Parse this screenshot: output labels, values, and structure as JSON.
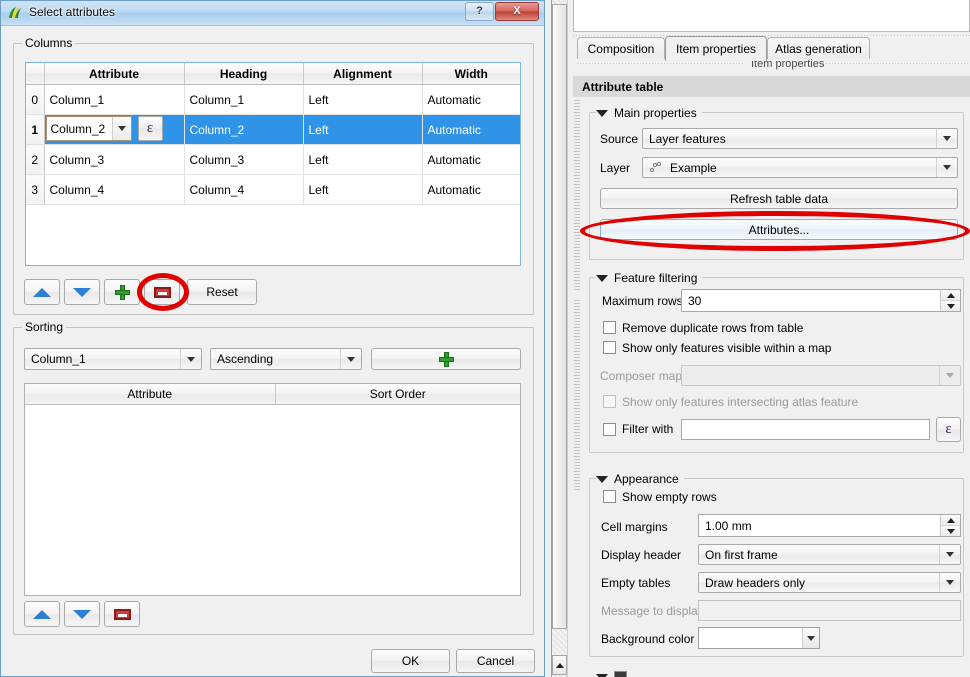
{
  "dialog": {
    "title": "Select attributes",
    "icon": "qgis-logo-icon",
    "help_label": "?",
    "close_label": "X",
    "columns_group": {
      "title": "Columns",
      "headers": [
        "",
        "Attribute",
        "Heading",
        "Alignment",
        "Width"
      ],
      "rows": [
        {
          "index": "0",
          "attribute": "Column_1",
          "heading": "Column_1",
          "alignment": "Left",
          "width": "Automatic",
          "selected": false,
          "editing": false
        },
        {
          "index": "1",
          "attribute": "Column_2",
          "heading": "Column_2",
          "alignment": "Left",
          "width": "Automatic",
          "selected": true,
          "editing": true
        },
        {
          "index": "2",
          "attribute": "Column_3",
          "heading": "Column_3",
          "alignment": "Left",
          "width": "Automatic",
          "selected": false,
          "editing": false
        },
        {
          "index": "3",
          "attribute": "Column_4",
          "heading": "Column_4",
          "alignment": "Left",
          "width": "Automatic",
          "selected": false,
          "editing": false
        }
      ],
      "expression_button_label": "ε",
      "toolbar": {
        "move_up": "move-up-icon",
        "move_down": "move-down-icon",
        "add": "add-icon",
        "remove": "remove-icon",
        "reset_label": "Reset"
      }
    },
    "sorting_group": {
      "title": "Sorting",
      "attribute_value": "Column_1",
      "order_value": "Ascending",
      "add_label": "add-icon",
      "headers": [
        "Attribute",
        "Sort Order"
      ],
      "rows": [],
      "toolbar": {
        "move_up": "move-up-icon",
        "move_down": "move-down-icon",
        "remove": "remove-icon"
      }
    },
    "ok_label": "OK",
    "cancel_label": "Cancel"
  },
  "right_panel": {
    "tabs": [
      {
        "label": "Composition",
        "active": false
      },
      {
        "label": "Item properties",
        "active": true
      },
      {
        "label": "Atlas generation",
        "active": false
      }
    ],
    "dock_title": "Item properties",
    "panel_header": "Attribute table",
    "main_properties": {
      "title": "Main properties",
      "source_label": "Source",
      "source_value": "Layer features",
      "layer_label": "Layer",
      "layer_value": "Example",
      "refresh_label": "Refresh table data",
      "attributes_label": "Attributes..."
    },
    "feature_filtering": {
      "title": "Feature filtering",
      "max_rows_label": "Maximum rows",
      "max_rows_value": "30",
      "remove_duplicates_label": "Remove duplicate rows from table",
      "remove_duplicates_checked": false,
      "visible_within_map_label": "Show only features visible within a map",
      "visible_within_map_checked": false,
      "composer_map_label": "Composer map",
      "composer_map_value": "",
      "intersecting_atlas_label": "Show only features intersecting atlas feature",
      "intersecting_atlas_checked": false,
      "filter_with_label": "Filter with",
      "filter_with_checked": false,
      "filter_with_value": "",
      "expression_button_label": "ε"
    },
    "appearance": {
      "title": "Appearance",
      "show_empty_rows_label": "Show empty rows",
      "show_empty_rows_checked": false,
      "cell_margins_label": "Cell margins",
      "cell_margins_value": "1.00 mm",
      "display_header_label": "Display header",
      "display_header_value": "On first frame",
      "empty_tables_label": "Empty tables",
      "empty_tables_value": "Draw headers only",
      "message_label": "Message to display",
      "message_value": "",
      "background_color_label": "Background color",
      "background_color_value": "#ffffff"
    }
  },
  "annotations": {
    "remove_column_highlight": "red-ellipse-annotation",
    "attributes_button_highlight": "red-ellipse-annotation",
    "color": "#e00000"
  }
}
